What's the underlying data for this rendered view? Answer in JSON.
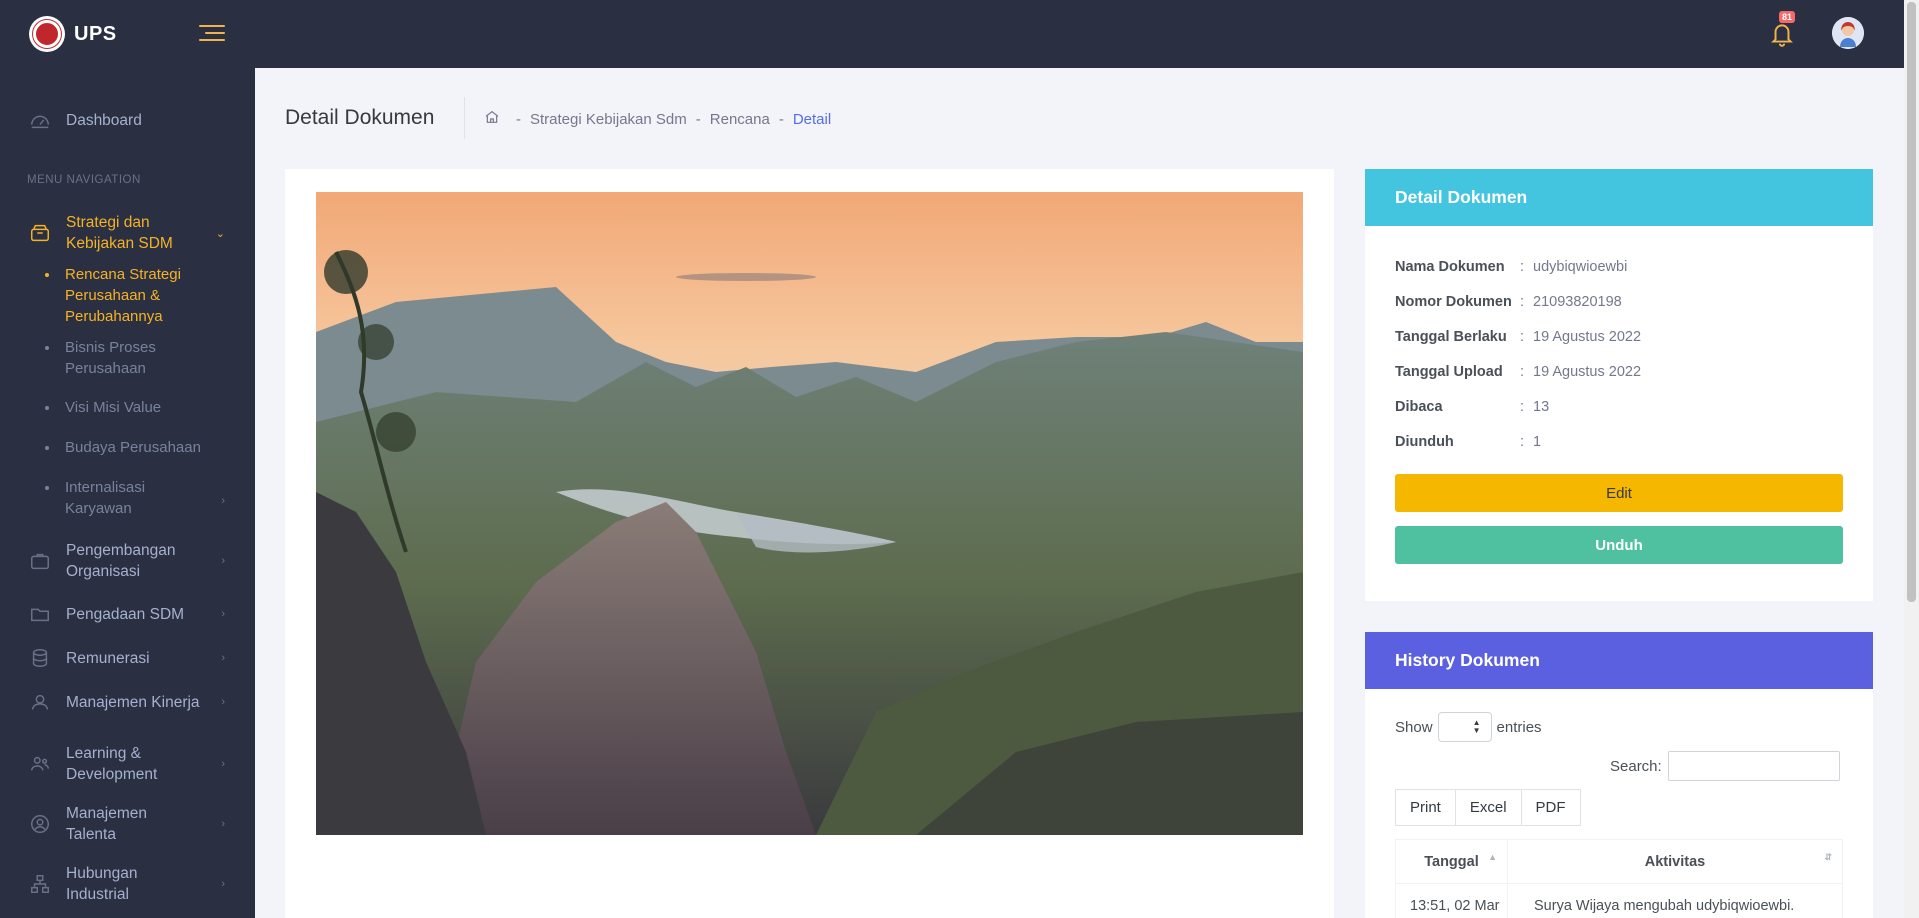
{
  "brand": {
    "name": "UPS"
  },
  "sidebar": {
    "dashboard": "Dashboard",
    "menu_title": "MENU NAVIGATION",
    "strategi": "Strategi dan Kebijakan SDM",
    "sub_items": [
      "Rencana Strategi Perusahaan & Perubahannya",
      "Bisnis Proses Perusahaan",
      "Visi Misi Value",
      "Budaya Perusahaan",
      "Internalisasi Karyawan"
    ],
    "items": [
      "Pengembangan Organisasi",
      "Pengadaan SDM",
      "Remunerasi",
      "Manajemen Kinerja",
      "Learning & Development",
      "Manajemen Talenta",
      "Hubungan Industrial"
    ]
  },
  "topbar": {
    "notification_count": "81"
  },
  "page": {
    "title": "Detail Dokumen",
    "breadcrumb": [
      "Strategi Kebijakan Sdm",
      "Rencana",
      "Detail"
    ]
  },
  "detail": {
    "heading": "Detail Dokumen",
    "rows": [
      {
        "key": "Nama Dokumen",
        "value": "udybiqwioewbi"
      },
      {
        "key": "Nomor Dokumen",
        "value": "21093820198"
      },
      {
        "key": "Tanggal Berlaku",
        "value": "19 Agustus 2022"
      },
      {
        "key": "Tanggal Upload",
        "value": "19 Agustus 2022"
      },
      {
        "key": "Dibaca",
        "value": "13"
      },
      {
        "key": "Diunduh",
        "value": "1"
      }
    ],
    "colon": ":",
    "edit_label": "Edit",
    "download_label": "Unduh"
  },
  "history": {
    "heading": "History Dokumen",
    "show_label": "Show",
    "entries_label": "entries",
    "search_label": "Search:",
    "buttons": [
      "Print",
      "Excel",
      "PDF"
    ],
    "columns": [
      "Tanggal",
      "Aktivitas"
    ],
    "rows": [
      {
        "date": "13:51, 02 Mar",
        "activity": "Surya Wijaya mengubah udybiqwioewbi."
      }
    ]
  },
  "colors": {
    "sidebar_bg": "#2a3042",
    "accent_active": "#f5b225",
    "detail_head": "#43c4df",
    "history_head": "#5b60e0",
    "edit_button": "#f5b700",
    "download_button": "#4fc0a0"
  }
}
